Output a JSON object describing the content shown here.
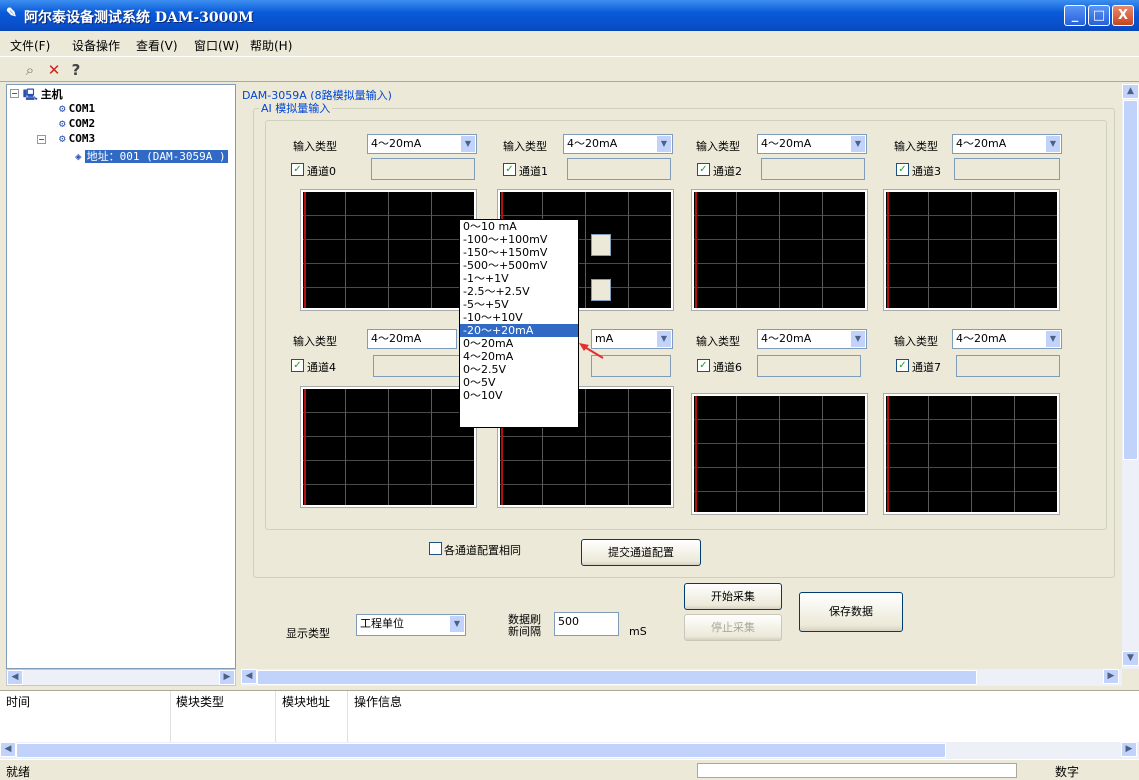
{
  "window": {
    "title": "阿尔泰设备测试系统 DAM-3000M",
    "min": "_",
    "max": "□",
    "close": "X"
  },
  "menu": [
    "文件(F)",
    "设备操作",
    "查看(V)",
    "窗口(W)",
    "帮助(H)"
  ],
  "toolbar": {
    "search": "⌕",
    "delete": "✕",
    "help": "?"
  },
  "tree": {
    "root": "主机",
    "coms": [
      "COM1",
      "COM2",
      "COM3"
    ],
    "address": "地址：001 (DAM-3059A )"
  },
  "panel": {
    "title": "DAM-3059A (8路模拟量输入)",
    "group": "AI 模拟量输入"
  },
  "input_type_label": "输入类型",
  "channels": [
    {
      "label": "通道0",
      "type": "4～20mA"
    },
    {
      "label": "通道1",
      "type": "4～20mA"
    },
    {
      "label": "通道2",
      "type": "4～20mA"
    },
    {
      "label": "通道3",
      "type": "4～20mA"
    },
    {
      "label": "通道4",
      "type": "4～20mA"
    },
    {
      "label": "",
      "type": "mA"
    },
    {
      "label": "通道6",
      "type": "4～20mA"
    },
    {
      "label": "通道7",
      "type": "4～20mA"
    }
  ],
  "dropdown": {
    "options": [
      "0～10 mA",
      "-100～+100mV",
      "-150～+150mV",
      "-500～+500mV",
      "-1～+1V",
      "-2.5～+2.5V",
      "-5～+5V",
      "-10～+10V",
      "-20～+20mA",
      "0～20mA",
      "4～20mA",
      "0～2.5V",
      "0～5V",
      "0～10V"
    ],
    "selected_index": 8
  },
  "same_config_label": "各通道配置相同",
  "submit_button": "提交通道配置",
  "display_type_label": "显示类型",
  "display_type_value": "工程单位",
  "refresh_label_1": "数据刷",
  "refresh_label_2": "新间隔",
  "refresh_value": "500",
  "refresh_unit": "mS",
  "start_button": "开始采集",
  "stop_button": "停止采集",
  "save_button": "保存数据",
  "log_columns": [
    "时间",
    "模块类型",
    "模块地址",
    "操作信息"
  ],
  "status": {
    "text": "就绪",
    "num": "数字"
  }
}
